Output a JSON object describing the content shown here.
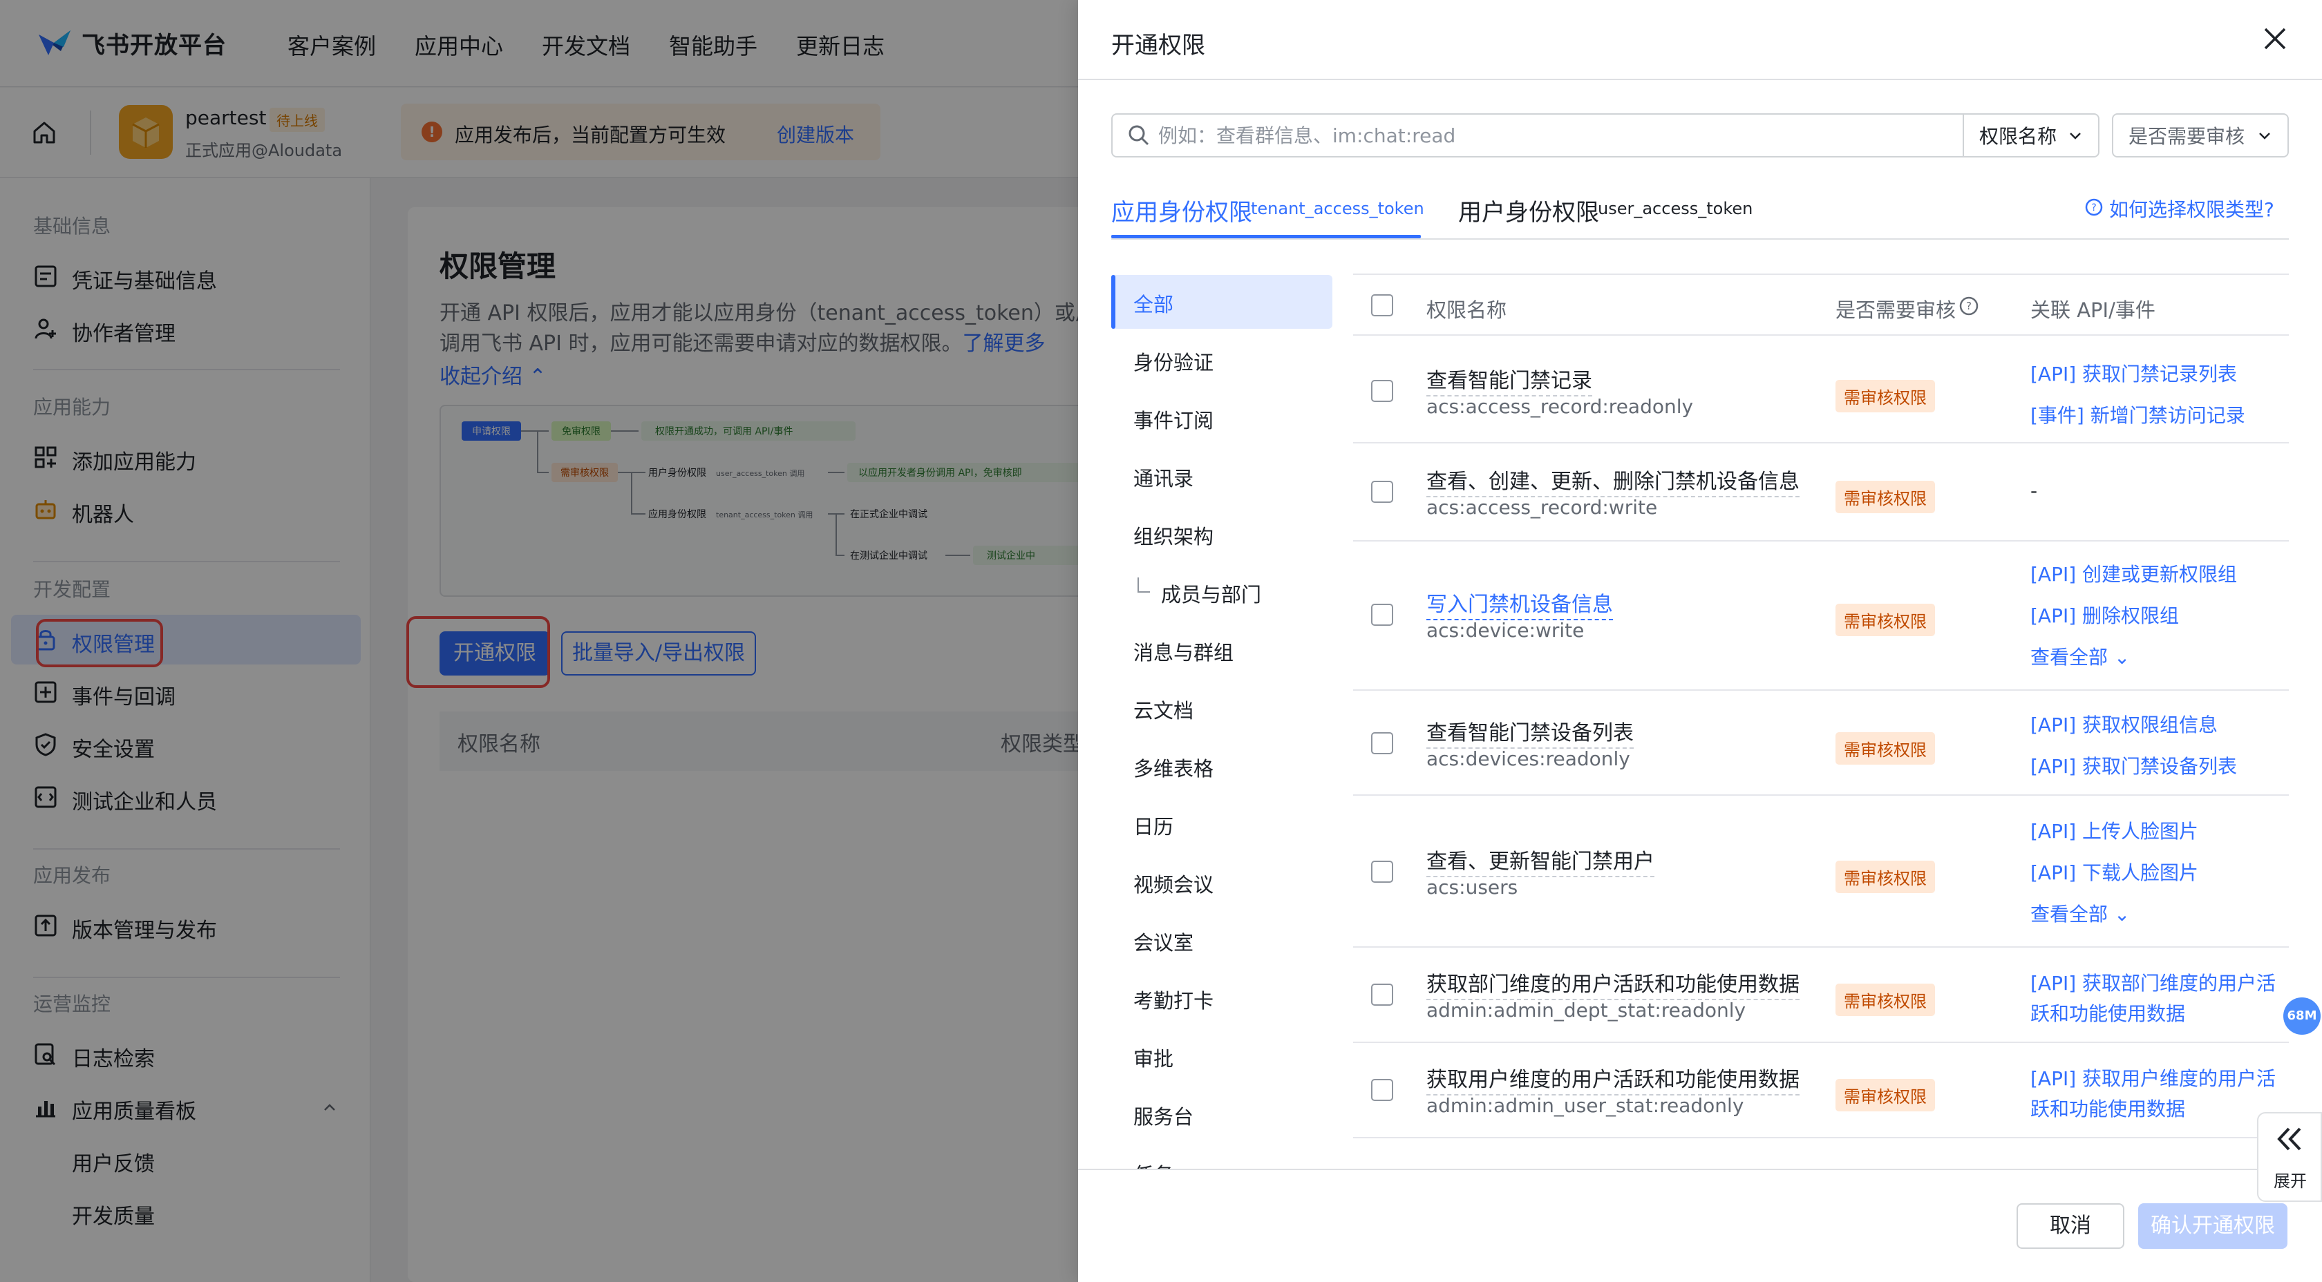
{
  "topnav": {
    "brand": "飞书开放平台",
    "links": [
      "客户案例",
      "应用中心",
      "开发文档",
      "智能助手",
      "更新日志"
    ]
  },
  "app": {
    "name": "peartest",
    "tag": "待上线",
    "subtitle": "正式应用@Aloudata"
  },
  "notice": {
    "text": "应用发布后，当前配置方可生效",
    "link": "创建版本"
  },
  "sidebar": {
    "sections": [
      {
        "title": "基础信息",
        "items": [
          {
            "label": "凭证与基础信息",
            "icon": "id-card-icon"
          },
          {
            "label": "协作者管理",
            "icon": "user-plus-icon"
          }
        ]
      },
      {
        "title": "应用能力",
        "items": [
          {
            "label": "添加应用能力",
            "icon": "grid-plus-icon"
          },
          {
            "label": "机器人",
            "icon": "robot-icon"
          }
        ]
      },
      {
        "title": "开发配置",
        "items": [
          {
            "label": "权限管理",
            "icon": "lock-icon",
            "active": true
          },
          {
            "label": "事件与回调",
            "icon": "event-icon"
          },
          {
            "label": "安全设置",
            "icon": "shield-icon"
          },
          {
            "label": "测试企业和人员",
            "icon": "test-icon"
          }
        ]
      },
      {
        "title": "应用发布",
        "items": [
          {
            "label": "版本管理与发布",
            "icon": "upload-icon"
          }
        ]
      },
      {
        "title": "运营监控",
        "items": [
          {
            "label": "日志检索",
            "icon": "log-search-icon"
          },
          {
            "label": "应用质量看板",
            "icon": "chart-icon"
          },
          {
            "label": "用户反馈",
            "icon": ""
          },
          {
            "label": "开发质量",
            "icon": ""
          }
        ]
      }
    ]
  },
  "main": {
    "title": "权限管理",
    "desc_line1": "开通 API 权限后，应用才能以应用身份（tenant_access_token）或用户身",
    "desc_line2": "调用飞书 API 时，应用可能还需要申请对应的数据权限。",
    "desc_link": "了解更多",
    "collapse": "收起介绍",
    "diagram": {
      "apply": "申请权限",
      "no_review": "免审权限",
      "success": "权限开通成功，可调用 API/事件",
      "need_review": "需审核权限",
      "user_identity": "用户身份权限",
      "user_token": "user_access_token 调用",
      "app_identity": "应用身份权限",
      "tenant_token": "tenant_access_token 调用",
      "dev_note": "以应用开发者身份调用 API，免审核即",
      "prod_debug": "在正式企业中调试",
      "test_debug": "在测试企业中调试",
      "test_tag": "测试企业中"
    },
    "btn_open": "开通权限",
    "btn_batch": "批量导入/导出权限",
    "table_head": [
      "权限名称",
      "权限类型"
    ]
  },
  "drawer": {
    "title": "开通权限",
    "search_placeholder": "例如：查看群信息、im:chat:read",
    "select1": "权限名称",
    "select2": "是否需要审核",
    "tabs": [
      {
        "label": "应用身份权限",
        "sub": "tenant_access_token"
      },
      {
        "label": "用户身份权限",
        "sub": "user_access_token"
      }
    ],
    "help": "如何选择权限类型?",
    "categories": [
      "全部",
      "身份验证",
      "事件订阅",
      "通讯录",
      "组织架构",
      "成员与部门",
      "消息与群组",
      "云文档",
      "多维表格",
      "日历",
      "视频会议",
      "会议室",
      "考勤打卡",
      "审批",
      "服务台",
      "任务"
    ],
    "columns": [
      "权限名称",
      "是否需要审核",
      "关联 API/事件"
    ],
    "rows": [
      {
        "name": "查看智能门禁记录",
        "code": "acs:access_record:readonly",
        "badge": "需审核权限",
        "apis": [
          "[API] 获取门禁记录列表",
          "[事件] 新增门禁访问记录"
        ]
      },
      {
        "name": "查看、创建、更新、删除门禁机设备信息",
        "code": "acs:access_record:write",
        "badge": "需审核权限",
        "apis": [
          "-"
        ]
      },
      {
        "name": "写入门禁机设备信息",
        "code": "acs:device:write",
        "badge": "需审核权限",
        "apis": [
          "[API] 创建或更新权限组",
          "[API] 删除权限组",
          "查看全部"
        ]
      },
      {
        "name": "查看智能门禁设备列表",
        "code": "acs:devices:readonly",
        "badge": "需审核权限",
        "apis": [
          "[API] 获取权限组信息",
          "[API] 获取门禁设备列表"
        ]
      },
      {
        "name": "查看、更新智能门禁用户",
        "code": "acs:users",
        "badge": "需审核权限",
        "apis": [
          "[API] 上传人脸图片",
          "[API] 下载人脸图片",
          "查看全部"
        ]
      },
      {
        "name": "获取部门维度的用户活跃和功能使用数据",
        "code": "admin:admin_dept_stat:readonly",
        "badge": "需审核权限",
        "apis": [
          "[API] 获取部门维度的用户活",
          "跃和功能使用数据"
        ]
      },
      {
        "name": "获取用户维度的用户活跃和功能使用数据",
        "code": "admin:admin_user_stat:readonly",
        "badge": "需审核权限",
        "apis": [
          "[API] 获取用户维度的用户活",
          "跃和功能使用数据"
        ]
      }
    ],
    "cancel": "取消",
    "confirm": "确认开通权限",
    "float_badge": "68M",
    "expand": "展开"
  }
}
